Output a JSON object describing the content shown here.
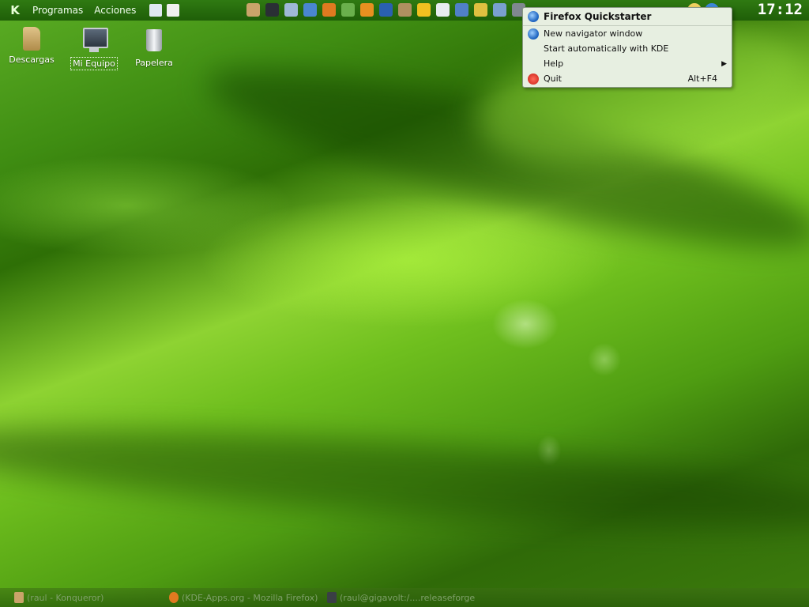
{
  "panel": {
    "menu_programs": "Programas",
    "menu_actions": "Acciones",
    "clock": "17:12"
  },
  "desktop": {
    "icons": [
      {
        "label": "Descargas",
        "icon": "folder-icon"
      },
      {
        "label": "Mi Equipo",
        "icon": "computer-icon"
      },
      {
        "label": "Papelera",
        "icon": "trash-icon"
      }
    ]
  },
  "context_menu": {
    "title": "Firefox Quickstarter",
    "items": [
      {
        "label": "New navigator window",
        "icon": "firefox-icon"
      },
      {
        "label": "Start automatically with KDE",
        "icon": ""
      },
      {
        "label": "Help",
        "icon": "",
        "submenu": true
      },
      {
        "label": "Quit",
        "icon": "power-icon",
        "shortcut": "Alt+F4"
      }
    ]
  },
  "taskbar": {
    "tasks": [
      {
        "label": "(raul - Konqueror)",
        "icon": "konqueror-icon"
      },
      {
        "label": "(KDE-Apps.org - Mozilla Firefox)",
        "icon": "firefox-icon"
      },
      {
        "label": "(raul@gigavolt:/....releaseforge",
        "icon": "terminal-icon"
      }
    ]
  },
  "colors": {
    "panel": "#1f5e08",
    "menu_bg": "#e7efe1",
    "clock": "#ffffff"
  }
}
